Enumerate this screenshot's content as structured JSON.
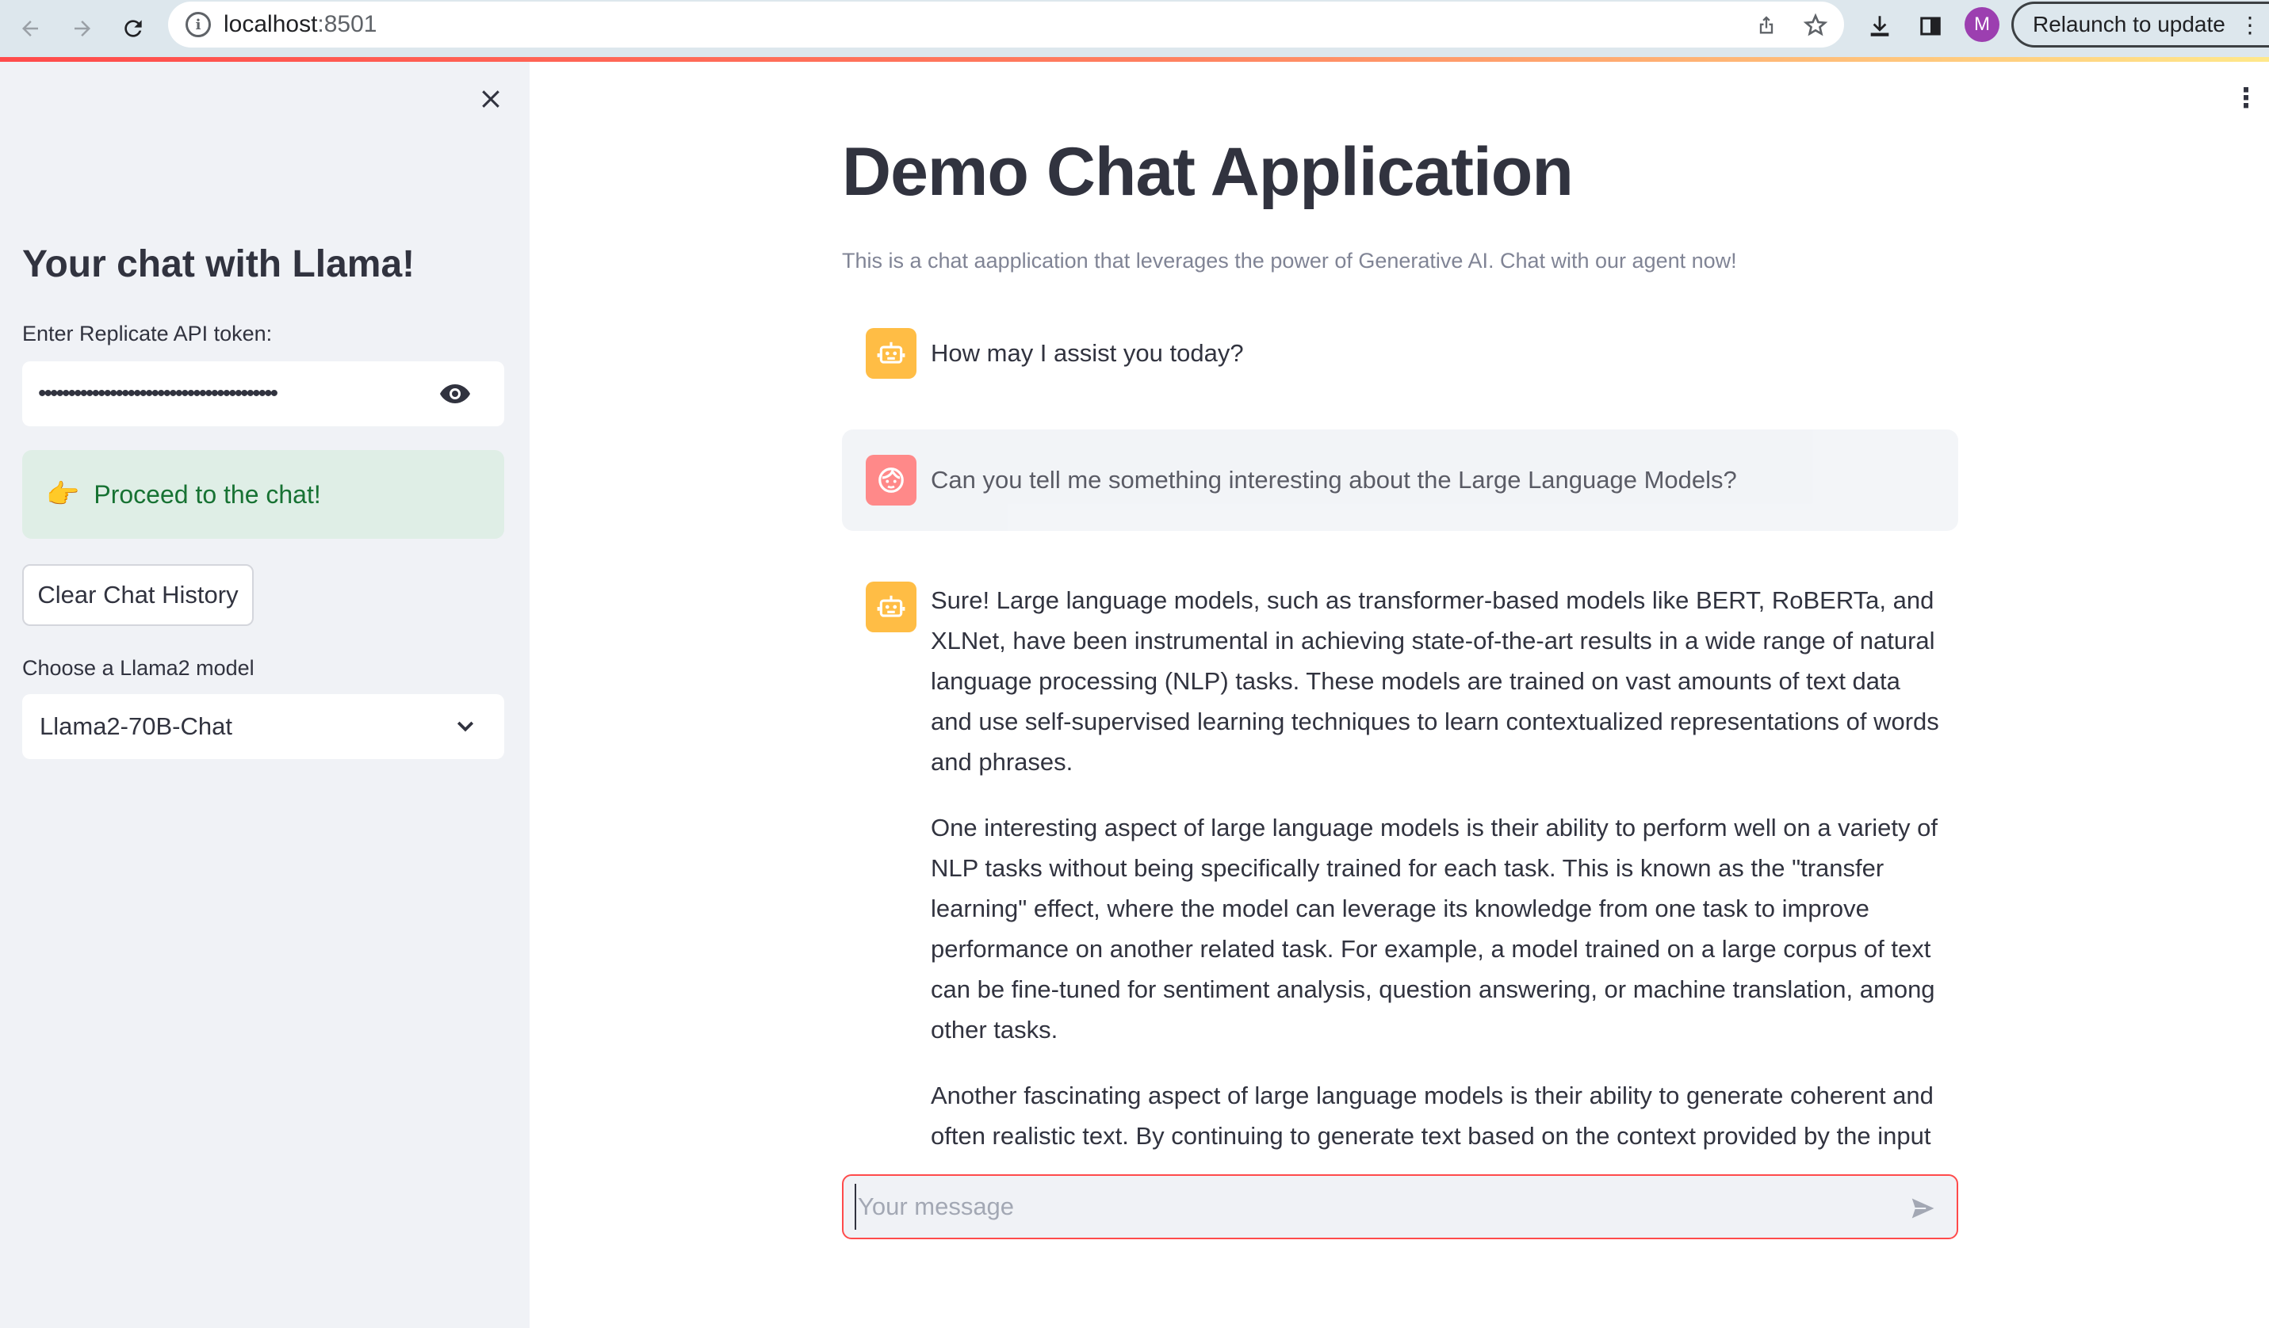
{
  "browser": {
    "url_host": "localhost",
    "url_port": ":8501",
    "profile_initial": "M",
    "relaunch_label": "Relaunch to update"
  },
  "sidebar": {
    "title": "Your chat with Llama!",
    "token_label": "Enter Replicate API token:",
    "token_value": "••••••••••••••••••••••••••••••••••••••••",
    "success_emoji": "👉",
    "success_text": "Proceed to the chat!",
    "clear_button": "Clear Chat History",
    "model_label": "Choose a Llama2 model",
    "model_selected": "Llama2-70B-Chat"
  },
  "main": {
    "title": "Demo Chat Application",
    "caption": "This is a chat aapplication that leverages the power of Generative AI. Chat with our agent now!",
    "messages": [
      {
        "role": "assistant",
        "paragraphs": [
          "How may I assist you today?"
        ]
      },
      {
        "role": "user",
        "paragraphs": [
          "Can you tell me something interesting about the Large Language Models?"
        ]
      },
      {
        "role": "assistant",
        "paragraphs": [
          "Sure! Large language models, such as transformer-based models like BERT, RoBERTa, and XLNet, have been instrumental in achieving state-of-the-art results in a wide range of natural language processing (NLP) tasks. These models are trained on vast amounts of text data and use self-supervised learning techniques to learn contextualized representations of words and phrases.",
          "One interesting aspect of large language models is their ability to perform well on a variety of NLP tasks without being specifically trained for each task. This is known as the \"transfer learning\" effect, where the model can leverage its knowledge from one task to improve performance on another related task. For example, a model trained on a large corpus of text can be fine-tuned for sentiment analysis, question answering, or machine translation, among other tasks.",
          "Another fascinating aspect of large language models is their ability to generate coherent and often realistic text. By continuing to generate text based on the context provided by the input prompt, these models can create engaging stories, articles, and even entire books. While still far from true human-level creativity, this capability has opened up new possibilities for content"
        ]
      }
    ],
    "input_placeholder": "Your message"
  },
  "colors": {
    "accent": "#ff4b4b",
    "bot_avatar": "#ffbd45",
    "user_avatar": "#ff6c6c",
    "success_bg": "#dfeee6",
    "success_text": "#177233",
    "sidebar_bg": "#f0f2f6"
  }
}
